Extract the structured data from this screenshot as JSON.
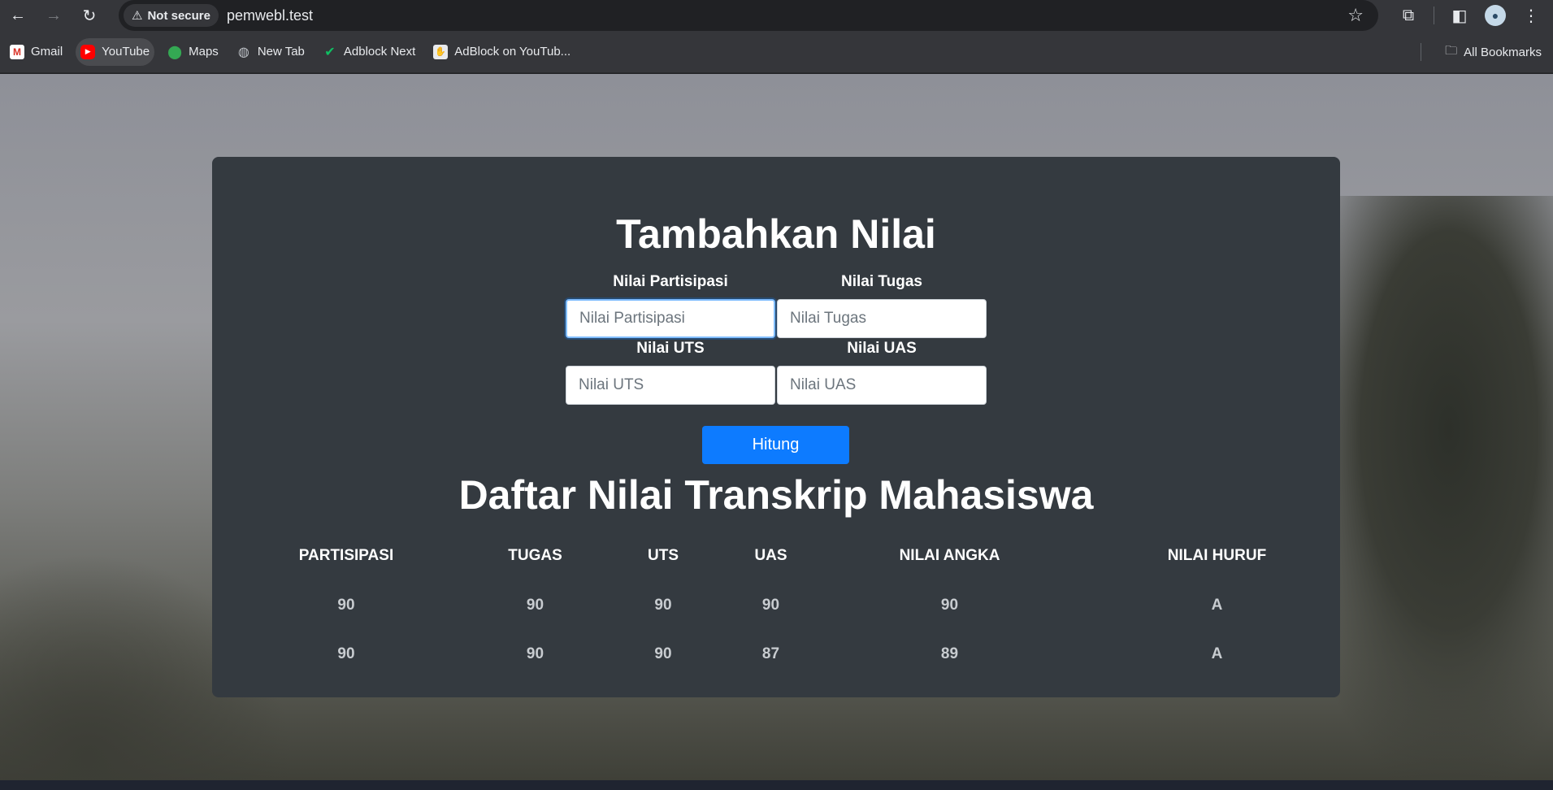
{
  "browser": {
    "security_label": "Not secure",
    "url": "pemwebl.test",
    "bookmarks": [
      {
        "label": "Gmail",
        "icon": "gmail-icon"
      },
      {
        "label": "YouTube",
        "icon": "youtube-icon"
      },
      {
        "label": "Maps",
        "icon": "maps-icon"
      },
      {
        "label": "New Tab",
        "icon": "globe-icon"
      },
      {
        "label": "Adblock Next",
        "icon": "adblock-next-icon"
      },
      {
        "label": "AdBlock on YouTub...",
        "icon": "adblock-youtube-icon"
      }
    ],
    "all_bookmarks_label": "All Bookmarks"
  },
  "form": {
    "title": "Tambahkan Nilai",
    "fields": [
      {
        "label": "Nilai Partisipasi",
        "placeholder": "Nilai Partisipasi",
        "value": ""
      },
      {
        "label": "Nilai Tugas",
        "placeholder": "Nilai Tugas",
        "value": ""
      },
      {
        "label": "Nilai UTS",
        "placeholder": "Nilai UTS",
        "value": ""
      },
      {
        "label": "Nilai UAS",
        "placeholder": "Nilai UAS",
        "value": ""
      }
    ],
    "submit_label": "Hitung",
    "accent_color": "#0d7bff"
  },
  "transcript": {
    "title": "Daftar Nilai Transkrip Mahasiswa",
    "columns": [
      "PARTISIPASI",
      "TUGAS",
      "UTS",
      "UAS",
      "NILAI ANGKA",
      "NILAI HURUF"
    ],
    "rows": [
      [
        "90",
        "90",
        "90",
        "90",
        "90",
        "A"
      ],
      [
        "90",
        "90",
        "90",
        "87",
        "89",
        "A"
      ]
    ]
  }
}
